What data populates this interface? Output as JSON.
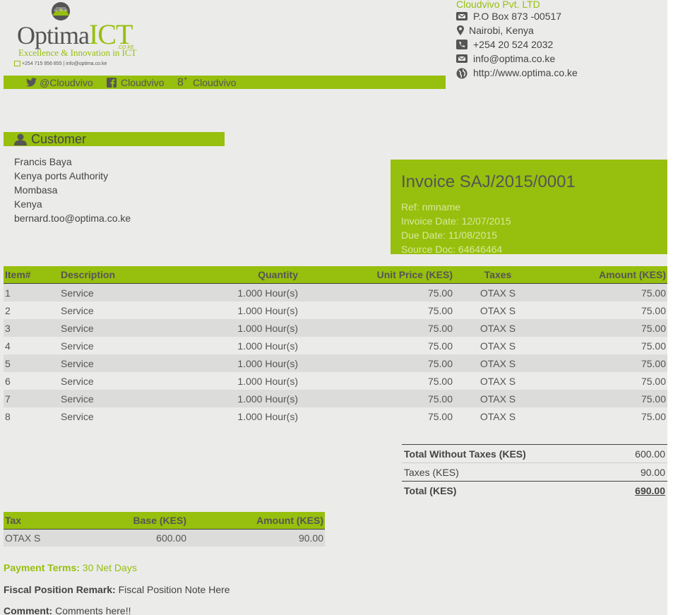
{
  "logo": {
    "word_main": "Optima",
    "word_accent": "ICT",
    "domain_suffix": ".CO.KE",
    "tagline": "Excellence & Innovation in ICT",
    "contact_line": "+254 715 956 855 | info@optima.co.ke"
  },
  "social": {
    "twitter": "@Cloudvivo",
    "facebook": "Cloudvivo",
    "googleplus": "Cloudvivo"
  },
  "company": {
    "name": "Cloudvivo Pvt. LTD",
    "address": "P.O Box 873 -00517",
    "city": "Nairobi,  Kenya",
    "phone": "+254 20 524 2032",
    "email": "info@optima.co.ke",
    "website": "http://www.optima.co.ke"
  },
  "customer": {
    "heading": "Customer",
    "name": "Francis Baya",
    "organization": "Kenya ports Authority",
    "city": "Mombasa",
    "country": "Kenya",
    "email": "bernard.too@optima.co.ke"
  },
  "invoice": {
    "title": "Invoice SAJ/2015/0001",
    "ref": "Ref: nmname",
    "date": "Invoice Date: 12/07/2015",
    "due": "Due Date: 11/08/2015",
    "source": "Source Doc: 64646464"
  },
  "lines": {
    "headers": [
      "Item#",
      "Description",
      "Quantity",
      "Unit Price (KES)",
      "Taxes",
      "Amount (KES)"
    ],
    "rows": [
      [
        "1",
        "Service",
        "1.000 Hour(s)",
        "75.00",
        "OTAX S",
        "75.00"
      ],
      [
        "2",
        "Service",
        "1.000 Hour(s)",
        "75.00",
        "OTAX S",
        "75.00"
      ],
      [
        "3",
        "Service",
        "1.000 Hour(s)",
        "75.00",
        "OTAX S",
        "75.00"
      ],
      [
        "4",
        "Service",
        "1.000 Hour(s)",
        "75.00",
        "OTAX S",
        "75.00"
      ],
      [
        "5",
        "Service",
        "1.000 Hour(s)",
        "75.00",
        "OTAX S",
        "75.00"
      ],
      [
        "6",
        "Service",
        "1.000 Hour(s)",
        "75.00",
        "OTAX S",
        "75.00"
      ],
      [
        "7",
        "Service",
        "1.000 Hour(s)",
        "75.00",
        "OTAX S",
        "75.00"
      ],
      [
        "8",
        "Service",
        "1.000 Hour(s)",
        "75.00",
        "OTAX S",
        "75.00"
      ]
    ]
  },
  "totals": {
    "untaxed_label": "Total Without Taxes (KES)",
    "untaxed_value": "600.00",
    "taxes_label": "Taxes (KES)",
    "taxes_value": "90.00",
    "total_label": "Total (KES)",
    "total_value": "690.00"
  },
  "tax_table": {
    "headers": [
      "Tax",
      "Base (KES)",
      "Amount (KES)"
    ],
    "rows": [
      [
        "OTAX S",
        "600.00",
        "90.00"
      ]
    ]
  },
  "notes": {
    "payment_label": "Payment Terms:",
    "payment_value": "30 Net Days",
    "fiscal_label": "Fiscal Position Remark:",
    "fiscal_value": "Fiscal Position Note Here",
    "comment_label": "Comment:",
    "comment_value": "Comments here!!"
  },
  "colors": {
    "accent": "#97bf0d",
    "page_background": "#ebebea",
    "row_stripe": "#dcdcdb",
    "text": "#444444"
  },
  "icons": {
    "logo": "mountain-emblem-icon",
    "social": [
      "twitter-icon",
      "facebook-icon",
      "googleplus-icon"
    ],
    "company": [
      "envelope-icon",
      "map-marker-icon",
      "phone-icon",
      "envelope-icon",
      "globe-icon"
    ],
    "customer": "user-icon"
  }
}
